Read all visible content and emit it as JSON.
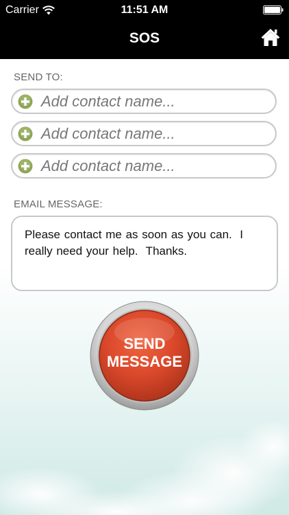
{
  "status_bar": {
    "carrier": "Carrier",
    "time": "11:51 AM"
  },
  "nav": {
    "title": "SOS",
    "home_icon": "home-icon"
  },
  "form": {
    "send_to_label": "SEND TO:",
    "contacts": [
      {
        "placeholder": "Add contact name..."
      },
      {
        "placeholder": "Add contact name..."
      },
      {
        "placeholder": "Add contact name..."
      }
    ],
    "email_label": "EMAIL MESSAGE:",
    "email_message": "Please contact me as soon as you can.  I really need your help.  Thanks."
  },
  "send_button": {
    "line1": "SEND",
    "line2": "MESSAGE"
  },
  "colors": {
    "nav_bg": "#000000",
    "add_icon": "#8fa55a",
    "send_button": "#d9472a"
  }
}
